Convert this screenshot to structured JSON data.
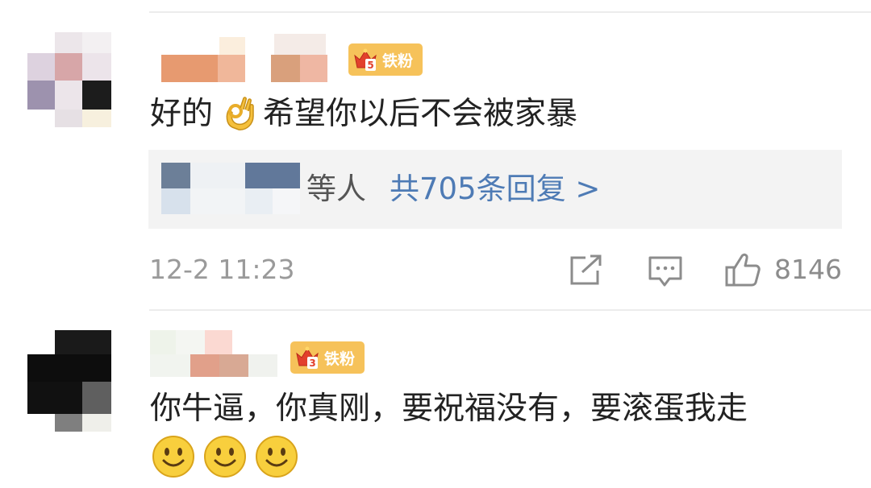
{
  "comments": [
    {
      "badge_label": "铁粉",
      "badge_level": "5",
      "text_before_emoji": "好的",
      "emoji": "ok-hand-emoji",
      "text_after_emoji": "希望你以后不会被家暴",
      "reply_summary": {
        "suffix": "等人",
        "link_text": "共705条回复 >"
      },
      "timestamp": "12-2 11:23",
      "like_count": "8146"
    },
    {
      "badge_label": "铁粉",
      "badge_level": "3",
      "text": "你牛逼，你真刚，要祝福没有，要滚蛋我走",
      "emojis": [
        "smile-emoji",
        "smile-emoji",
        "smile-emoji"
      ]
    }
  ],
  "colors": {
    "link": "#4e7bb5",
    "badge": "#f6c25a",
    "muted": "#9a9a9a"
  },
  "icons": [
    "share-icon",
    "comment-icon",
    "thumbs-up-icon"
  ]
}
